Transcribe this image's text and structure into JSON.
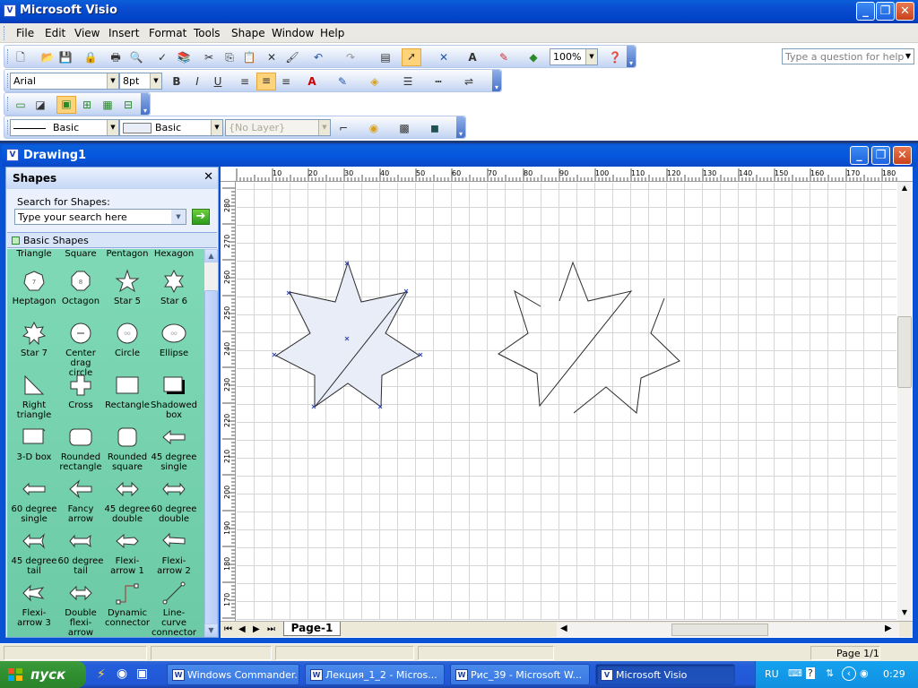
{
  "app": {
    "title": "Microsoft Visio"
  },
  "menu": [
    "File",
    "Edit",
    "View",
    "Insert",
    "Format",
    "Tools",
    "Shape",
    "Window",
    "Help"
  ],
  "help_placeholder": "Type a question for help",
  "toolbar": {
    "zoom": "100%",
    "font": "Arial",
    "size": "8pt",
    "line_style": "Basic",
    "fill_style": "Basic",
    "layer": "{No Layer}"
  },
  "document": {
    "title": "Drawing1"
  },
  "shapes_panel": {
    "title": "Shapes",
    "search_label": "Search for Shapes:",
    "search_placeholder": "Type your search here",
    "stencil": "Basic Shapes",
    "top_labels": [
      "Triangle",
      "Square",
      "Pentagon",
      "Hexagon"
    ],
    "items": [
      {
        "label": "Heptagon",
        "icon": "heptagon-icon"
      },
      {
        "label": "Octagon",
        "icon": "octagon-icon"
      },
      {
        "label": "Star 5",
        "icon": "star5-icon"
      },
      {
        "label": "Star 6",
        "icon": "star6-icon"
      },
      {
        "label": "Star 7",
        "icon": "star7-icon"
      },
      {
        "label": "Center drag circle",
        "icon": "center-drag-circle-icon"
      },
      {
        "label": "Circle",
        "icon": "circle-icon"
      },
      {
        "label": "Ellipse",
        "icon": "ellipse-icon"
      },
      {
        "label": "Right triangle",
        "icon": "right-triangle-icon"
      },
      {
        "label": "Cross",
        "icon": "cross-icon"
      },
      {
        "label": "Rectangle",
        "icon": "rectangle-icon"
      },
      {
        "label": "Shadowed box",
        "icon": "shadowed-box-icon"
      },
      {
        "label": "3-D box",
        "icon": "3d-box-icon"
      },
      {
        "label": "Rounded rectangle",
        "icon": "rounded-rectangle-icon"
      },
      {
        "label": "Rounded square",
        "icon": "rounded-square-icon"
      },
      {
        "label": "45 degree single",
        "icon": "arrow-45-single-icon"
      },
      {
        "label": "60 degree single",
        "icon": "arrow-60-single-icon"
      },
      {
        "label": "Fancy arrow",
        "icon": "fancy-arrow-icon"
      },
      {
        "label": "45 degree double",
        "icon": "arrow-45-double-icon"
      },
      {
        "label": "60 degree double",
        "icon": "arrow-60-double-icon"
      },
      {
        "label": "45 degree tail",
        "icon": "arrow-45-tail-icon"
      },
      {
        "label": "60 degree tail",
        "icon": "arrow-60-tail-icon"
      },
      {
        "label": "Flexi-arrow 1",
        "icon": "flexi-arrow-1-icon"
      },
      {
        "label": "Flexi-arrow 2",
        "icon": "flexi-arrow-2-icon"
      },
      {
        "label": "Flexi-arrow 3",
        "icon": "flexi-arrow-3-icon"
      },
      {
        "label": "Double flexi-arrow",
        "icon": "double-flexi-arrow-icon"
      },
      {
        "label": "Dynamic connector",
        "icon": "dynamic-connector-icon"
      },
      {
        "label": "Line-curve connector",
        "icon": "line-curve-connector-icon"
      }
    ]
  },
  "ruler": {
    "h_labels": [
      "10",
      "20",
      "30",
      "40",
      "50",
      "60",
      "70",
      "80",
      "90",
      "100",
      "110",
      "120",
      "130",
      "140",
      "150",
      "160",
      "170",
      "180"
    ],
    "v_labels": [
      "280",
      "270",
      "260",
      "250",
      "240",
      "230",
      "220",
      "210",
      "200",
      "190",
      "180",
      "170"
    ]
  },
  "page_tab": "Page-1",
  "status": {
    "page": "Page 1/1"
  },
  "taskbar": {
    "start": "пуск",
    "tasks": [
      "Windows Commander...",
      "Лекция_1_2 - Micros...",
      "Рис_39 - Microsoft W...",
      "Microsoft Visio"
    ],
    "lang": "RU",
    "time": "0:29"
  },
  "colors": {
    "title_blue": "#0a4bd0",
    "stencil_green": "#7fd9b7",
    "shape_fill": "#e8edf8"
  }
}
